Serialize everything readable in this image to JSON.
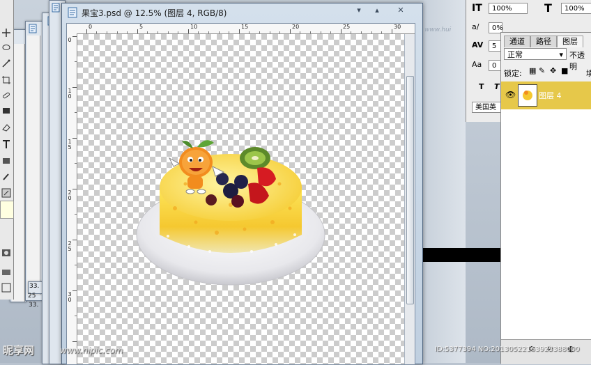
{
  "document": {
    "title": "果宝3.psd @ 12.5% (图层 4, RGB/8)",
    "ruler_h_labels": [
      "0",
      "5",
      "10",
      "15",
      "20",
      "25",
      "30"
    ],
    "ruler_v_labels": [
      "0",
      "1 0",
      "1 5",
      "2 0",
      "2 5",
      "3 0"
    ]
  },
  "background_windows": {
    "zoom_a": "33.",
    "zoom_b": "25"
  },
  "character_panel": {
    "tracking_value": "100%",
    "scale_value": "100%",
    "leading_value": "0%",
    "kerning_value": "5",
    "baseline_value": "0",
    "language": "美国英",
    "corner_watermark": "www.hui"
  },
  "layers_panel": {
    "tabs": [
      "通道",
      "路径",
      "图层"
    ],
    "active_tab": "图层",
    "blend_mode": "正常",
    "opacity_label": "不透明",
    "lock_label": "锁定:",
    "fill_label": "填",
    "layer_name": "图层 4"
  },
  "watermark": {
    "logo": "昵享网",
    "url": "www.nipic.com",
    "id_text": "ID:5377394 NO:20130522163923388000"
  },
  "colors": {
    "accent_layer": "#e6c84a",
    "window_frame": "#51667f"
  }
}
